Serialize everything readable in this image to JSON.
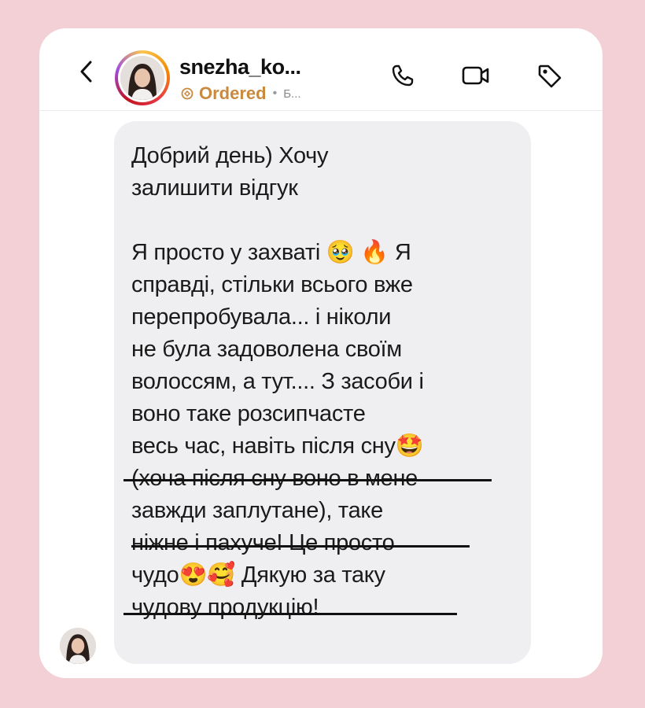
{
  "header": {
    "back_icon": "chevron-left-icon",
    "username": "snezha_ko...",
    "order_icon": "order-badge-icon",
    "order_status": "Ordered",
    "separator": "•",
    "subtitle_truncated": "Б...",
    "icons": [
      "phone-icon",
      "video-icon",
      "tag-icon"
    ]
  },
  "message": {
    "text": "Добрий день) Хочу\nзалишити відгук\n\nЯ просто у захваті 🥹 🔥 Я\nсправді, стільки всього вже\nперепробувала... і ніколи\nне була задоволена своїм\nволоссям, а тут.... З засоби і\nвоно таке розсипчасте\nвесь час, навіть після сну🤩\n(хоча після сну воно в мене\nзавжди заплутане), таке\nніжне і пахуче! Це просто\nчудо😍🥰 Дякую за таку\nчудову продукцію!"
  },
  "colors": {
    "background": "#f3cfd6",
    "bubble": "#efeff1",
    "order_status": "#c9893e"
  }
}
